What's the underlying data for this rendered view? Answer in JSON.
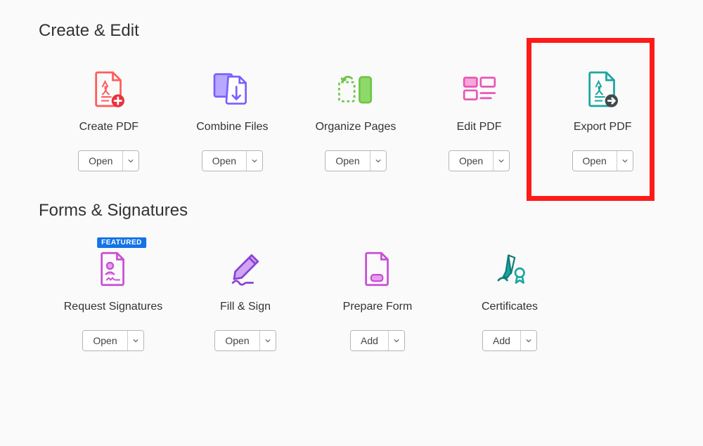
{
  "sections": {
    "create_edit": {
      "title": "Create & Edit",
      "tools": [
        {
          "label": "Create PDF",
          "button": "Open"
        },
        {
          "label": "Combine Files",
          "button": "Open"
        },
        {
          "label": "Organize Pages",
          "button": "Open"
        },
        {
          "label": "Edit PDF",
          "button": "Open"
        },
        {
          "label": "Export PDF",
          "button": "Open",
          "highlighted": true
        }
      ]
    },
    "forms_signatures": {
      "title": "Forms & Signatures",
      "tools": [
        {
          "label": "Request Signatures",
          "button": "Open",
          "badge": "FEATURED"
        },
        {
          "label": "Fill & Sign",
          "button": "Open"
        },
        {
          "label": "Prepare Form",
          "button": "Add"
        },
        {
          "label": "Certificates",
          "button": "Add"
        }
      ]
    }
  }
}
